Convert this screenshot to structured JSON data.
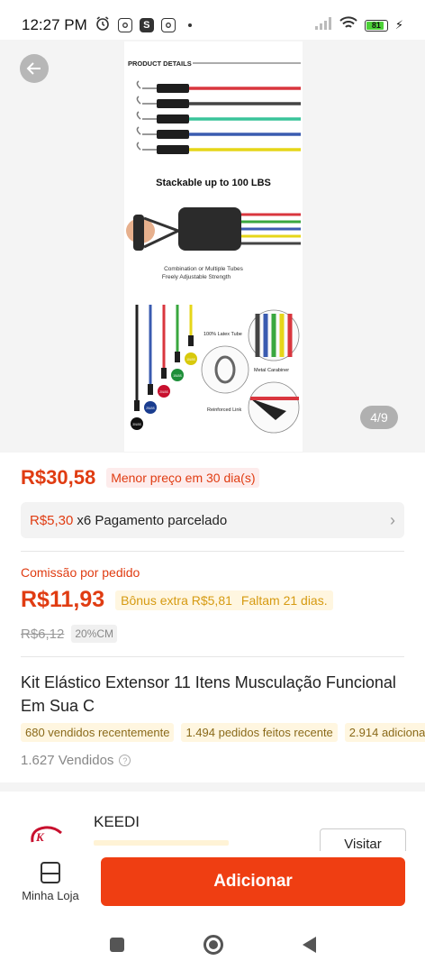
{
  "status_bar": {
    "time": "12:27 PM",
    "battery": "81"
  },
  "gallery": {
    "counter": "4/9",
    "image": {
      "heading": "PRODUCT DETAILS",
      "stackable": "Stackable up to 100 LBS",
      "combo_line1": "Combination or Multiple Tubes",
      "combo_line2": "Freely Adjustable Strength",
      "callout_latex": "100% Latex Tube",
      "callout_carabiner": "Metal Carabiner",
      "callout_link": "Reinforced Link",
      "tube_colors": [
        "#d9363e",
        "#444444",
        "#39c49a",
        "#3a5bb0",
        "#e6d619"
      ],
      "weight_tags": [
        "30LBS",
        "25LBS",
        "20LBS",
        "15LBS",
        "10LBS"
      ]
    }
  },
  "price": {
    "current": "R$30,58",
    "lowest_badge": "Menor preço em 30 dia(s)"
  },
  "installments": {
    "amount": "R$5,30",
    "text": "x6 Pagamento parcelado"
  },
  "commission": {
    "label": "Comissão por pedido",
    "value": "R$11,93",
    "bonus": "Bônus extra R$5,81",
    "remaining": "Faltam 21 dias.",
    "old_value": "R$6,12",
    "percent_badge": "20%CM"
  },
  "product": {
    "title": "Kit Elástico Extensor 11 Itens Musculação Funcional Em Sua C",
    "chips": [
      "680 vendidos recentemente",
      "1.494 pedidos feitos recente",
      "2.914 adiciona"
    ],
    "sold": "1.627 Vendidos"
  },
  "shop": {
    "name": "KEEDI",
    "visit_label": "Visitar"
  },
  "bottom_bar": {
    "store_label": "Minha Loja",
    "add_label": "Adicionar"
  },
  "colors": {
    "accent": "#ef3e12",
    "price": "#e03c12"
  }
}
